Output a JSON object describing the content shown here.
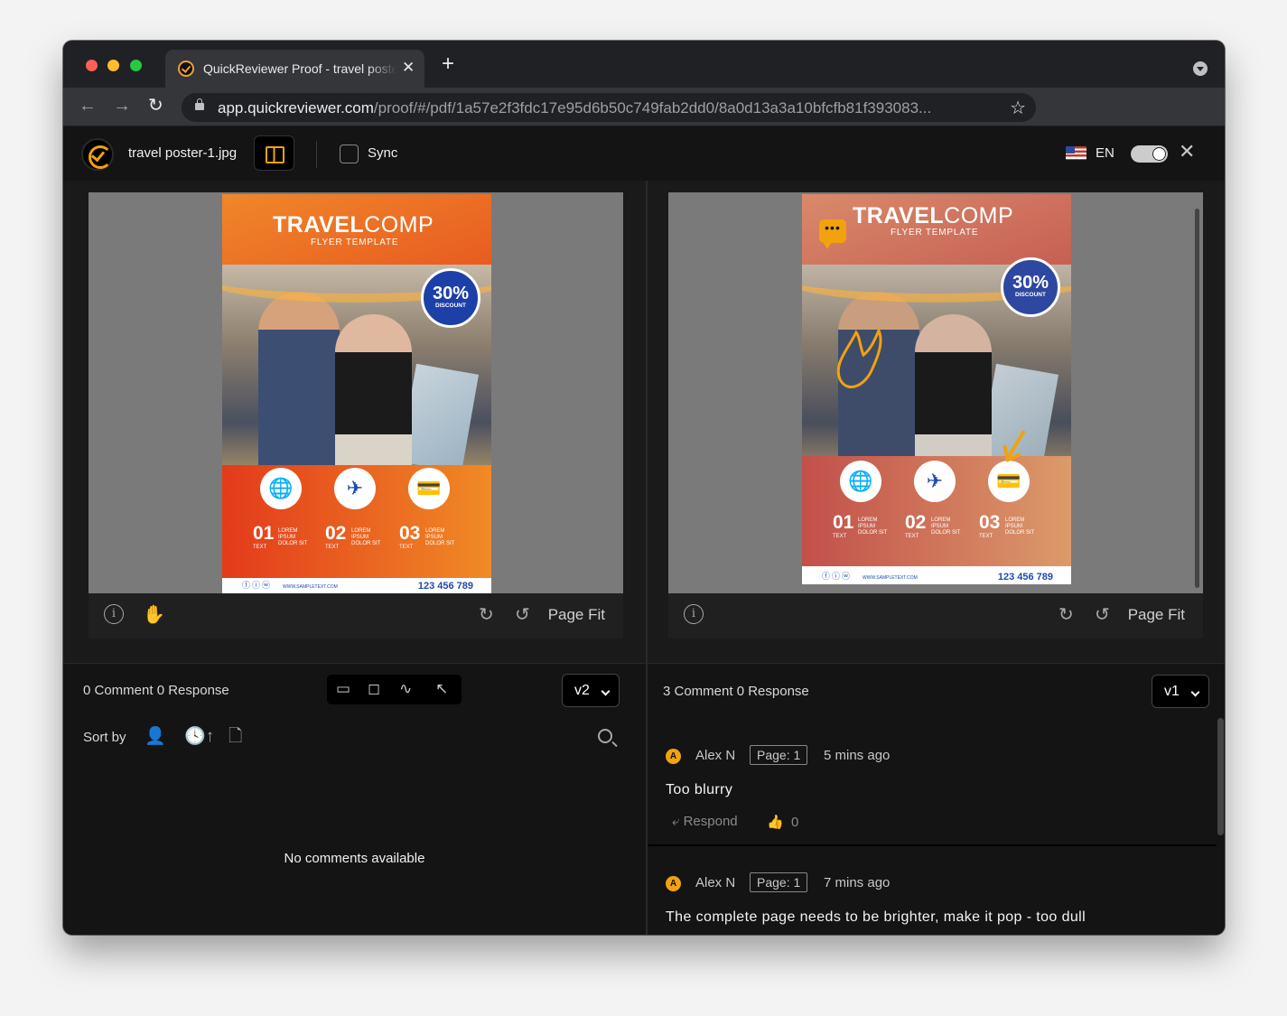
{
  "browser": {
    "tab_title": "QuickReviewer Proof - travel poster",
    "url_host": "app.quickreviewer.com",
    "url_path": "/proof/#/pdf/1a57e2f3fdc17e95d6b50c749fab2dd0/8a0d13a3a10bfcfb81f393083..."
  },
  "app": {
    "file_name": "travel poster-1.jpg",
    "sync_label": "Sync",
    "language": "EN",
    "brand_color": "#f2a20e"
  },
  "viewer": {
    "page_fit_label": "Page Fit"
  },
  "poster": {
    "title_bold": "TRAVEL",
    "title_light": "COMP",
    "subtitle": "FLYER TEMPLATE",
    "discount": "30%",
    "discount_label": "DISCOUNT",
    "steps": [
      {
        "num": "01",
        "label": "LOREM IPSUM DOLOR SIT",
        "caption": "TEXT"
      },
      {
        "num": "02",
        "label": "LOREM IPSUM DOLOR SIT",
        "caption": "TEXT"
      },
      {
        "num": "03",
        "label": "LOREM IPSUM DOLOR SIT",
        "caption": "TEXT"
      }
    ],
    "website": "WWW.SAMPLETEXT.COM",
    "phone": "123 456 789"
  },
  "left_panel": {
    "count_text": "0 Comment 0 Response",
    "version": "v2",
    "sort_label": "Sort by",
    "empty_text": "No comments available"
  },
  "right_panel": {
    "count_text": "3 Comment 0 Response",
    "version": "v1",
    "comments": [
      {
        "avatar": "A",
        "author": "Alex N",
        "page": "Page: 1",
        "time": "5 mins ago",
        "text": "Too blurry",
        "respond": "Respond",
        "likes": "0"
      },
      {
        "avatar": "A",
        "author": "Alex N",
        "page": "Page: 1",
        "time": "7 mins ago",
        "text": "The complete page needs to be brighter, make it pop - too dull"
      }
    ]
  }
}
